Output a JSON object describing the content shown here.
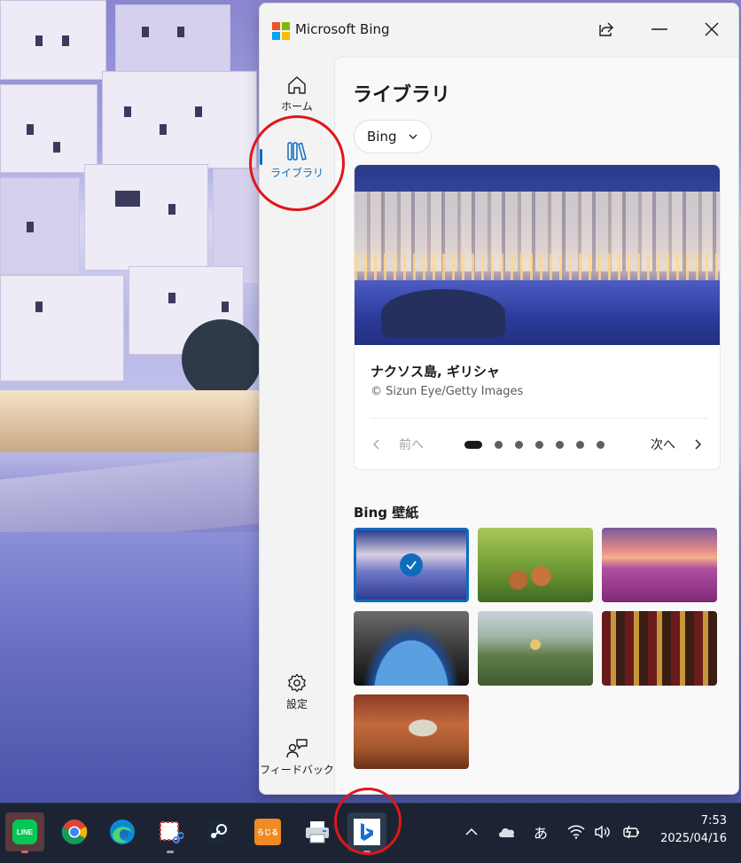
{
  "app": {
    "title": "Microsoft Bing",
    "logo_colors": [
      "#f25022",
      "#7fba00",
      "#00a4ef",
      "#ffb900"
    ]
  },
  "nav": {
    "items": [
      {
        "label": "ホーム",
        "icon": "home-icon"
      },
      {
        "label": "ライブラリ",
        "icon": "library-icon",
        "active": true
      },
      {
        "label": "設定",
        "icon": "gear-icon"
      },
      {
        "label": "フィードバック",
        "icon": "feedback-icon"
      }
    ]
  },
  "page": {
    "title": "ライブラリ",
    "filter_value": "Bing"
  },
  "featured": {
    "title": "ナクソス島, ギリシャ",
    "credit": "© Sizun Eye/Getty Images",
    "prev_label": "前へ",
    "next_label": "次へ",
    "dot_count": 7,
    "active_dot": 0
  },
  "wallpapers": {
    "section_title": "Bing 壁紙",
    "items": [
      {
        "subject": "naxos-town",
        "selected": true
      },
      {
        "subject": "fox-cubs"
      },
      {
        "subject": "tulip-field-windmill"
      },
      {
        "subject": "earth-from-space-station"
      },
      {
        "subject": "temple-on-hill"
      },
      {
        "subject": "ornate-shrine-float"
      },
      {
        "subject": "red-rock-arch"
      }
    ]
  },
  "taskbar": {
    "apps": [
      "line-icon",
      "chrome-icon",
      "edge-icon",
      "snipping-tool-icon",
      "steam-icon",
      "radiko-icon",
      "printer-icon",
      "bing-icon"
    ],
    "line_label": "LINE",
    "radiko_label": "らじる",
    "ime_label": "あ",
    "time": "7:53",
    "date": "2025/04/16"
  },
  "colors": {
    "accent": "#0f6cbd",
    "annotation_ring": "#e0161a"
  }
}
